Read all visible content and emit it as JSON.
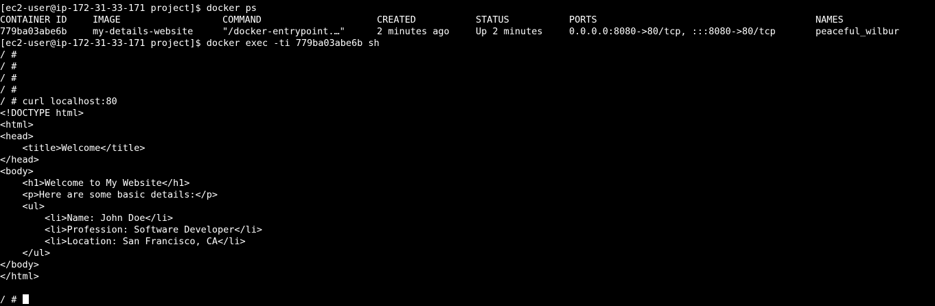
{
  "colors": {
    "background": "#000000",
    "foreground": "#ffffff"
  },
  "terminal": {
    "prompt1": "[ec2-user@ip-172-31-33-171 project]$ docker ps",
    "ps_headers": [
      "CONTAINER ID",
      "IMAGE",
      "COMMAND",
      "CREATED",
      "STATUS",
      "PORTS",
      "NAMES"
    ],
    "ps_row": [
      "779ba03abe6b",
      "my-details-website",
      "\"/docker-entrypoint.…\"",
      "2 minutes ago",
      "Up 2 minutes",
      "0.0.0.0:8080->80/tcp, :::8080->80/tcp",
      "peaceful_wilbur"
    ],
    "prompt2": "[ec2-user@ip-172-31-33-171 project]$ docker exec -ti 779ba03abe6b sh",
    "shell1": "/ #",
    "shell2": "/ #",
    "shell3": "/ #",
    "shell4": "/ #",
    "curl_cmd": "/ # curl localhost:80",
    "html_lines": [
      "<!DOCTYPE html>",
      "<html>",
      "<head>",
      "    <title>Welcome</title>",
      "</head>",
      "<body>",
      "    <h1>Welcome to My Website</h1>",
      "    <p>Here are some basic details:</p>",
      "    <ul>",
      "        <li>Name: John Doe</li>",
      "        <li>Profession: Software Developer</li>",
      "        <li>Location: San Francisco, CA</li>",
      "    </ul>",
      "</body>",
      "</html>"
    ],
    "final_prompt": "/ # "
  }
}
